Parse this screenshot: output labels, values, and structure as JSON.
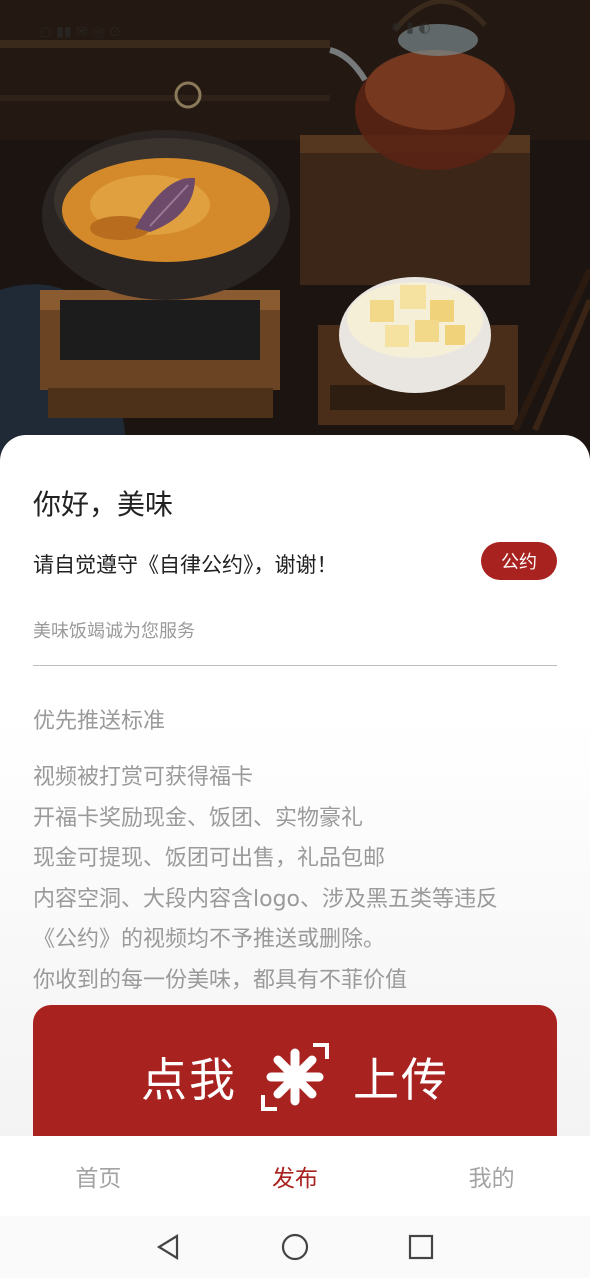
{
  "status_bar": {
    "left_icons": "◻ ▮▮ ✉ ◎ ⊙",
    "right_icons": "✹ ▮ ◐"
  },
  "hero": {
    "image": "food-photo-curry-bowl-teapot-tofu"
  },
  "card": {
    "greeting": "你好，美味",
    "rule_text": "请自觉遵守《自律公约》，谢谢！",
    "pact_button": "公约",
    "service_text": "美味饭竭诚为您服务",
    "section_title": "优先推送标准",
    "description_lines": [
      "视频被打赏可获得福卡",
      "开福卡奖励现金、饭团、实物豪礼",
      "现金可提现、饭团可出售，礼品包邮",
      "内容空洞、大段内容含logo、涉及黑五类等违反",
      "《公约》的视频均不予推送或删除。",
      "你收到的每一份美味，都具有不菲价值"
    ]
  },
  "upload_button": {
    "left_label": "点我",
    "right_label": "上传",
    "icon": "sparkle-scan-icon"
  },
  "tabs": [
    {
      "label": "首页",
      "active": false
    },
    {
      "label": "发布",
      "active": true
    },
    {
      "label": "我的",
      "active": false
    }
  ],
  "colors": {
    "accent": "#a8221f",
    "muted_text": "#9a9a9a",
    "primary_text": "#222222"
  },
  "system_nav": {
    "back": "back-triangle-icon",
    "home": "home-circle-icon",
    "recent": "recent-square-icon"
  }
}
